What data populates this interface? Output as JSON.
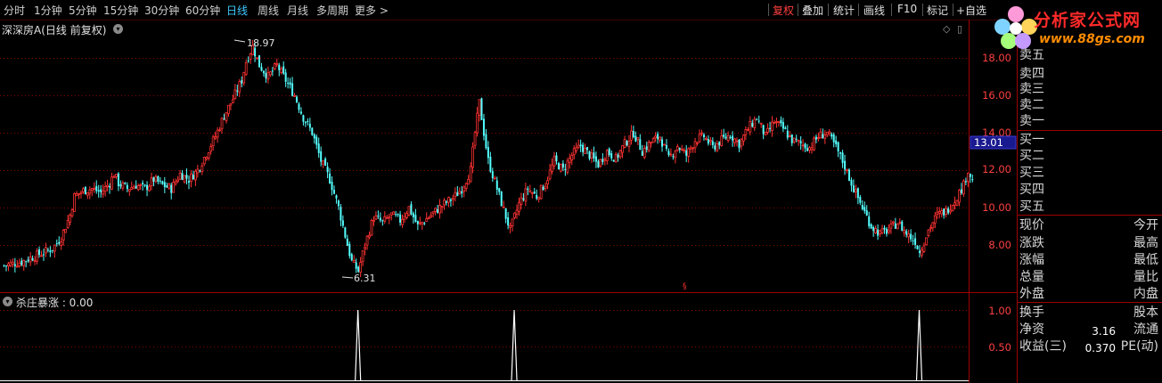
{
  "toolbar": {
    "periods": [
      "分时",
      "1分钟",
      "5分钟",
      "15分钟",
      "30分钟",
      "60分钟",
      "日线",
      "周线",
      "月线",
      "多周期",
      "更多 >"
    ],
    "active_period": "日线",
    "buttons": [
      "复权",
      "叠加",
      "统计",
      "画线",
      "F10",
      "标记",
      "+自选"
    ],
    "active_button": "复权"
  },
  "subtitle": "深深房A(日线 前复权)",
  "logo": {
    "title": "分析家公式网",
    "url": "www.88gs.com"
  },
  "main_chart": {
    "price_ticks": [
      "18.00",
      "16.00",
      "14.00",
      "12.00",
      "10.00",
      "8.00"
    ],
    "current_price": "13.01",
    "high_marker": "18.97",
    "low_marker": "6.31"
  },
  "indicator": {
    "label": "杀庄暴涨 : 0.00",
    "ticks": [
      "1.00",
      "0.50"
    ]
  },
  "order_book": {
    "sell": [
      "卖五",
      "卖四",
      "卖三",
      "卖二",
      "卖一"
    ],
    "buy": [
      "买一",
      "买二",
      "买三",
      "买四",
      "买五"
    ]
  },
  "quote_panel": {
    "left": [
      "现价",
      "涨跌",
      "涨幅",
      "总量",
      "外盘"
    ],
    "right": [
      "今开",
      "最高",
      "最低",
      "量比",
      "内盘"
    ],
    "left2": [
      "换手",
      "净资",
      "收益(三)"
    ],
    "right2": [
      "股本",
      "流通",
      "PE(动)"
    ],
    "values": {
      "净资": "3.16",
      "收益(三)": "0.370"
    }
  },
  "colors": {
    "up": "#ff3232",
    "down": "#54ffff",
    "grid": "#8b0000",
    "active": "#3ec8ff"
  },
  "chart_data": {
    "type": "candlestick",
    "title": "深深房A(日线 前复权)",
    "ylim": [
      6.0,
      19.5
    ],
    "y_ticks": [
      8,
      10,
      12,
      14,
      16,
      18
    ],
    "marked_high": 18.97,
    "marked_low": 6.31,
    "last_price": 13.01,
    "close_path": [
      [
        0,
        6.9
      ],
      [
        8,
        7.1
      ],
      [
        12,
        7.3
      ],
      [
        16,
        7.5
      ],
      [
        22,
        7.8
      ],
      [
        26,
        8.4
      ],
      [
        30,
        9.6
      ],
      [
        32,
        10.6
      ],
      [
        36,
        10.9
      ],
      [
        40,
        11.0
      ],
      [
        44,
        10.8
      ],
      [
        48,
        11.3
      ],
      [
        50,
        11.8
      ],
      [
        52,
        11.3
      ],
      [
        56,
        11.0
      ],
      [
        60,
        11.2
      ],
      [
        64,
        11.0
      ],
      [
        68,
        11.5
      ],
      [
        72,
        11.2
      ],
      [
        76,
        11.0
      ],
      [
        80,
        11.8
      ],
      [
        84,
        11.5
      ],
      [
        88,
        12.0
      ],
      [
        92,
        12.9
      ],
      [
        96,
        13.8
      ],
      [
        100,
        14.9
      ],
      [
        104,
        15.8
      ],
      [
        108,
        16.8
      ],
      [
        110,
        17.8
      ],
      [
        113,
        18.6
      ],
      [
        116,
        17.6
      ],
      [
        120,
        17.0
      ],
      [
        124,
        17.6
      ],
      [
        128,
        16.8
      ],
      [
        132,
        16.0
      ],
      [
        136,
        14.8
      ],
      [
        140,
        14.0
      ],
      [
        144,
        12.5
      ],
      [
        148,
        11.5
      ],
      [
        152,
        10.0
      ],
      [
        156,
        8.0
      ],
      [
        158,
        7.1
      ],
      [
        161,
        6.6
      ],
      [
        164,
        8.0
      ],
      [
        168,
        9.5
      ],
      [
        172,
        9.2
      ],
      [
        176,
        9.6
      ],
      [
        180,
        9.3
      ],
      [
        184,
        10.0
      ],
      [
        188,
        9.0
      ],
      [
        192,
        9.4
      ],
      [
        196,
        9.8
      ],
      [
        200,
        10.2
      ],
      [
        204,
        10.5
      ],
      [
        208,
        11.0
      ],
      [
        212,
        12.0
      ],
      [
        214,
        14.0
      ],
      [
        216,
        15.6
      ],
      [
        218,
        14.0
      ],
      [
        220,
        12.5
      ],
      [
        224,
        11.0
      ],
      [
        228,
        9.5
      ],
      [
        230,
        8.8
      ],
      [
        234,
        10.2
      ],
      [
        238,
        11.0
      ],
      [
        242,
        10.6
      ],
      [
        246,
        11.3
      ],
      [
        250,
        12.5
      ],
      [
        254,
        12.0
      ],
      [
        258,
        12.8
      ],
      [
        262,
        13.3
      ],
      [
        266,
        12.8
      ],
      [
        270,
        12.3
      ],
      [
        274,
        13.0
      ],
      [
        278,
        12.6
      ],
      [
        282,
        13.4
      ],
      [
        286,
        14.0
      ],
      [
        290,
        13.0
      ],
      [
        294,
        13.5
      ],
      [
        298,
        13.8
      ],
      [
        302,
        12.6
      ],
      [
        306,
        13.3
      ],
      [
        310,
        12.8
      ],
      [
        314,
        13.6
      ],
      [
        318,
        13.8
      ],
      [
        322,
        13.2
      ],
      [
        326,
        13.6
      ],
      [
        330,
        13.9
      ],
      [
        334,
        13.4
      ],
      [
        338,
        14.2
      ],
      [
        342,
        14.8
      ],
      [
        346,
        13.8
      ],
      [
        350,
        14.6
      ],
      [
        354,
        14.2
      ],
      [
        358,
        13.6
      ],
      [
        362,
        13.4
      ],
      [
        366,
        13.2
      ],
      [
        370,
        13.8
      ],
      [
        374,
        14.0
      ],
      [
        378,
        13.2
      ],
      [
        382,
        12.2
      ],
      [
        386,
        11.0
      ],
      [
        390,
        10.0
      ],
      [
        394,
        9.0
      ],
      [
        398,
        8.6
      ],
      [
        402,
        8.8
      ],
      [
        406,
        9.2
      ],
      [
        410,
        8.6
      ],
      [
        414,
        8.2
      ],
      [
        416,
        7.6
      ],
      [
        420,
        8.8
      ],
      [
        424,
        9.6
      ],
      [
        428,
        9.8
      ],
      [
        432,
        10.4
      ],
      [
        436,
        11.2
      ],
      [
        438,
        12.0
      ],
      [
        440,
        11.4
      ]
    ],
    "indicator": {
      "name": "杀庄暴涨",
      "current_value": 0.0,
      "ylim": [
        0,
        1.0
      ],
      "signals_at_bar": [
        161,
        232,
        416
      ]
    }
  }
}
